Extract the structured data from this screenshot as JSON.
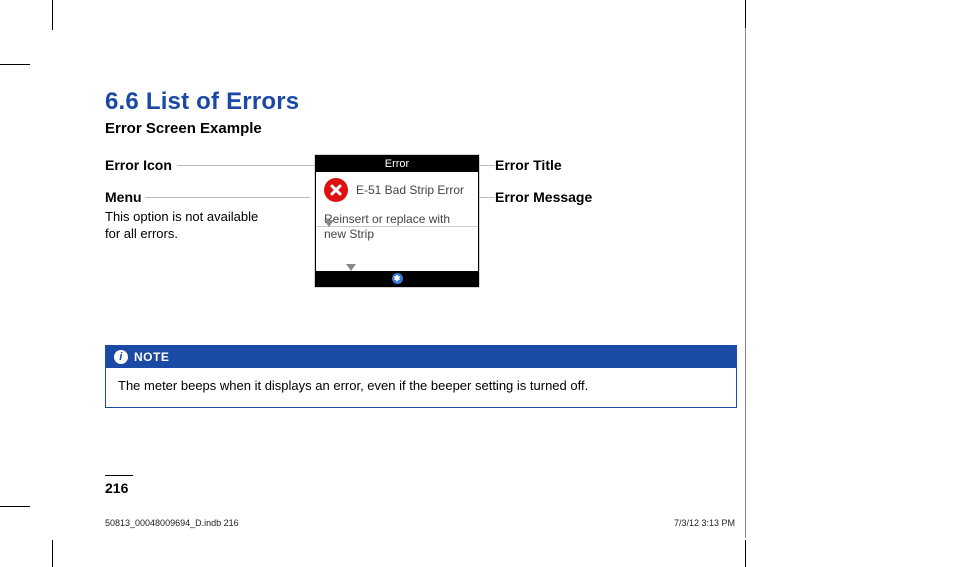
{
  "heading": "6.6 List of Errors",
  "subheading": "Error Screen Example",
  "callouts": {
    "error_icon": "Error Icon",
    "menu": "Menu",
    "menu_note": "This option is not available for all errors.",
    "error_title": "Error Title",
    "error_message": "Error Message"
  },
  "screen": {
    "titlebar": "Error",
    "message_title": "E-51 Bad Strip Error",
    "message_body": "Reinsert or replace with new Strip",
    "bluetooth_symbol": "✱"
  },
  "note": {
    "label": "NOTE",
    "text": "The meter beeps when it displays an error, even if the beeper setting is turned off."
  },
  "page_number": "216",
  "slug_left": "50813_00048009694_D.indb   216",
  "slug_right": "7/3/12   3:13 PM"
}
